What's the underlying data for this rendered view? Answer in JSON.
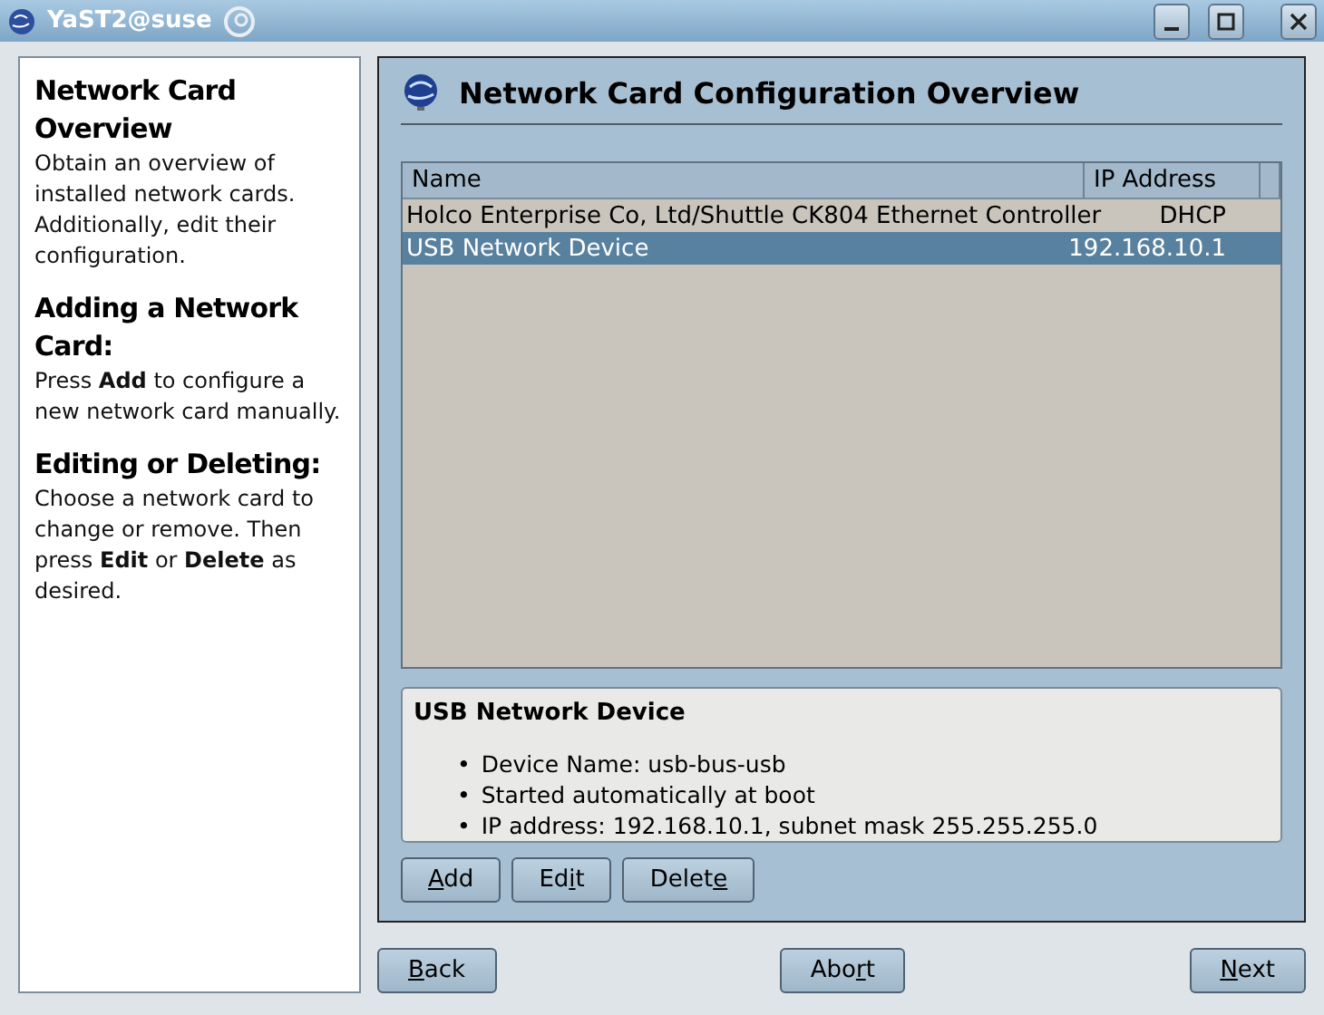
{
  "window": {
    "title": "YaST2@suse"
  },
  "help": [
    {
      "heading": "Network Card Overview",
      "text": "Obtain an overview of installed network cards. Additionally, edit their configuration."
    },
    {
      "heading": "Adding a Network Card:",
      "text": "Press **Add** to configure a new network card manually."
    },
    {
      "heading": "Editing or Deleting:",
      "text": "Choose a network card to change or remove. Then press **Edit** or **Delete** as desired."
    }
  ],
  "page_title": "Network Card Configuration Overview",
  "table": {
    "columns": [
      "Name",
      "IP Address"
    ],
    "rows": [
      {
        "cells": [
          "Holco Enterprise Co, Ltd/Shuttle CK804 Ethernet Controller",
          "DHCP"
        ],
        "selected": false
      },
      {
        "cells": [
          "USB Network Device",
          "192.168.10.1"
        ],
        "selected": true
      }
    ]
  },
  "details": {
    "title": "USB Network Device",
    "items": [
      {
        "bullet": "•",
        "text": "Device Name: usb-bus-usb"
      },
      {
        "bullet": "•",
        "text": "Started automatically at boot"
      },
      {
        "bullet": "•",
        "text": "IP address: 192.168.10.1, subnet mask 255.255.255.0"
      }
    ]
  },
  "actions": [
    {
      "key": "A",
      "after": "dd"
    },
    {
      "before": "Ed",
      "key": "i",
      "after": "t"
    },
    {
      "before": "Delet",
      "key": "e"
    }
  ],
  "nav": [
    {
      "key": "B",
      "after": "ack"
    },
    {
      "before": "Abo",
      "key": "r",
      "after": "t"
    },
    {
      "key": "N",
      "after": "ext"
    }
  ]
}
